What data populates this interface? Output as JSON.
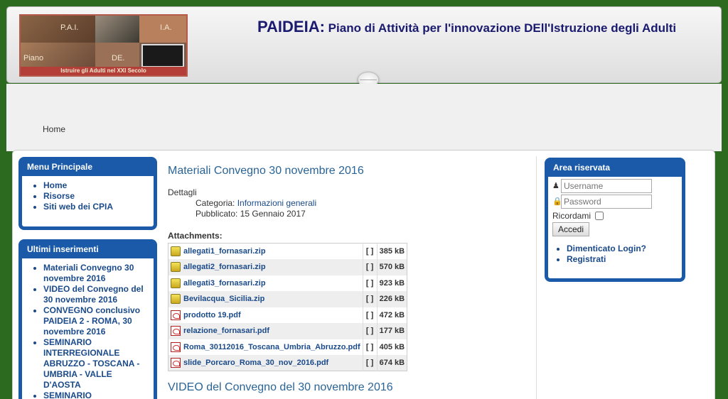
{
  "header": {
    "title_prefix": "PAIDEIA:",
    "title_rest": "Piano di Attività per l'innovazione DEll'Istruzione degli Adulti",
    "logo": {
      "label_pai": "P.A.I.",
      "label_ia": "I.A.",
      "label_piano": "Piano",
      "label_de": "DE.",
      "tagline": "Istruire gli Adulti nel XXI Secolo"
    }
  },
  "breadcrumb": {
    "home": "Home"
  },
  "menu_principale": {
    "title": "Menu Principale",
    "items": [
      "Home",
      "Risorse",
      "Siti web dei CPIA"
    ]
  },
  "ultimi_inserimenti": {
    "title": "Ultimi inserimenti",
    "items": [
      "Materiali Convegno 30 novembre 2016",
      "VIDEO del Convegno del 30 novembre 2016",
      "CONVEGNO conclusivo PAIDEIA 2 - ROMA, 30 novembre 2016",
      "SEMINARIO INTERREGIONALE ABRUZZO - TOSCANA - UMBRIA - VALLE D'AOSTA",
      "SEMINARIO INTERREGIONALE"
    ]
  },
  "article": {
    "title": "Materiali Convegno 30 novembre 2016",
    "details_label": "Dettagli",
    "category_label": "Categoria:",
    "category_value": "Informazioni generali",
    "published_label": "Pubblicato:",
    "published_value": "15 Gennaio 2017",
    "attachments_label": "Attachments:",
    "attachments": [
      {
        "name": "allegati1_fornasari.zip",
        "type": "zip",
        "brackets": "[ ]",
        "size": "385 kB"
      },
      {
        "name": "allegati2_fornasari.zip",
        "type": "zip",
        "brackets": "[ ]",
        "size": "570 kB"
      },
      {
        "name": "allegati3_fornasari.zip",
        "type": "zip",
        "brackets": "[ ]",
        "size": "923 kB"
      },
      {
        "name": "Bevilacqua_Sicilia.zip",
        "type": "zip",
        "brackets": "[ ]",
        "size": "226 kB"
      },
      {
        "name": "prodotto 19.pdf",
        "type": "pdf",
        "brackets": "[ ]",
        "size": "472 kB"
      },
      {
        "name": "relazione_fornasari.pdf",
        "type": "pdf",
        "brackets": "[ ]",
        "size": "177 kB"
      },
      {
        "name": "Roma_30112016_Toscana_Umbria_Abruzzo.pdf",
        "type": "pdf",
        "brackets": "[ ]",
        "size": "405 kB"
      },
      {
        "name": "slide_Porcaro_Roma_30_nov_2016.pdf",
        "type": "pdf",
        "brackets": "[ ]",
        "size": "674 kB"
      }
    ]
  },
  "article2": {
    "title": "VIDEO del Convegno del 30 novembre 2016"
  },
  "area_riservata": {
    "title": "Area riservata",
    "username_placeholder": "Username",
    "password_placeholder": "Password",
    "remember_label": "Ricordami",
    "submit_label": "Accedi",
    "links": [
      "Dimenticato Login?",
      "Registrati"
    ]
  }
}
